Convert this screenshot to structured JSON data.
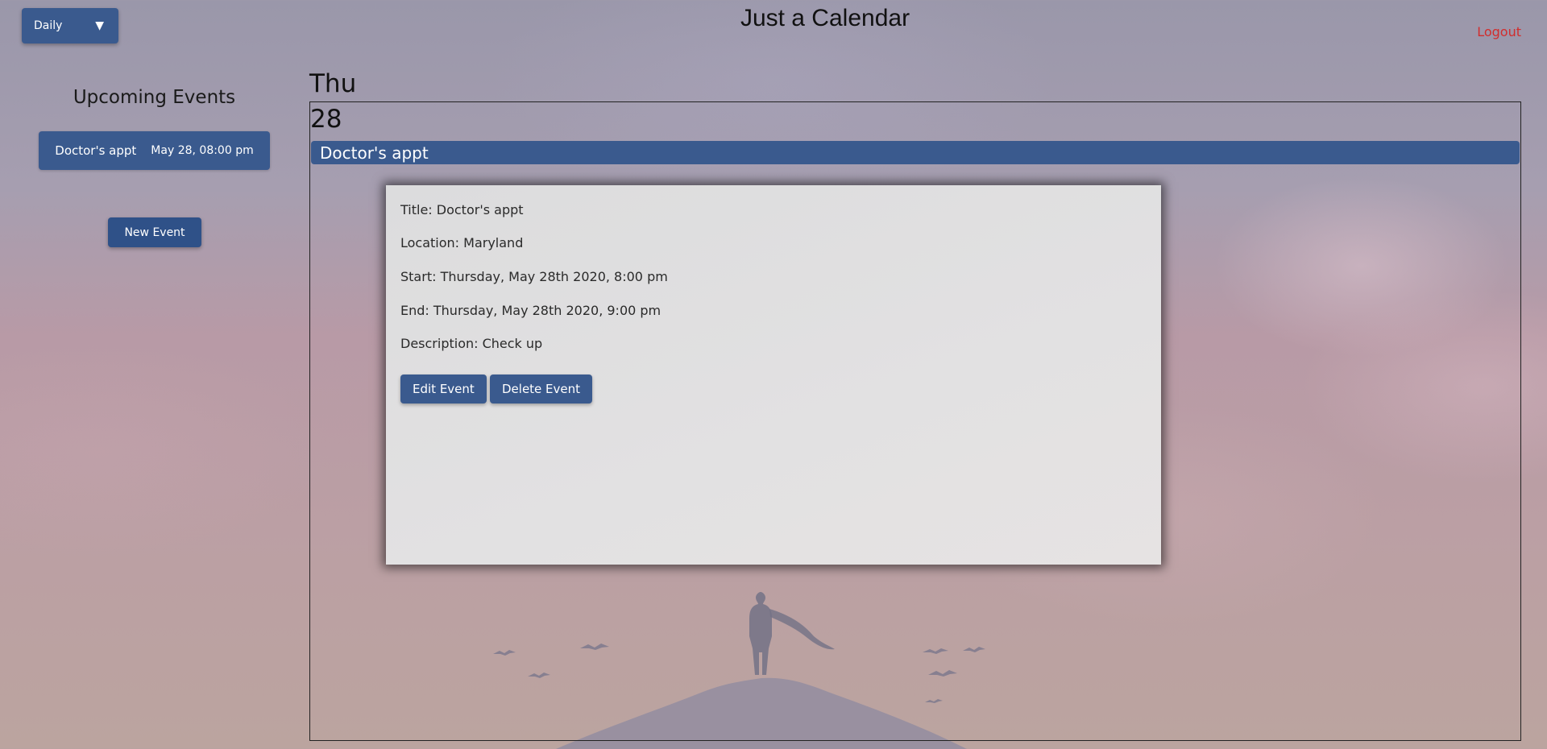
{
  "header": {
    "view_select": {
      "value": "Daily",
      "caret": "▼"
    },
    "title": "Just a Calendar",
    "logout_label": "Logout"
  },
  "sidebar": {
    "heading": "Upcoming Events",
    "events": [
      {
        "title": "Doctor's appt",
        "when": "May 28, 08:00 pm"
      }
    ],
    "new_event_label": "New Event"
  },
  "day_view": {
    "day_name": "Thu",
    "day_number": "28",
    "events": [
      {
        "title": "Doctor's appt"
      }
    ]
  },
  "event_popup": {
    "title_line": "Title: Doctor's appt",
    "location_line": "Location: Maryland",
    "start_line": "Start: Thursday, May 28th 2020, 8:00 pm",
    "end_line": "End: Thursday, May 28th 2020, 9:00 pm",
    "description_line": "Description: Check up",
    "edit_label": "Edit Event",
    "delete_label": "Delete Event"
  },
  "colors": {
    "primary": "#3a5a8e",
    "logout": "#d22d2d"
  }
}
